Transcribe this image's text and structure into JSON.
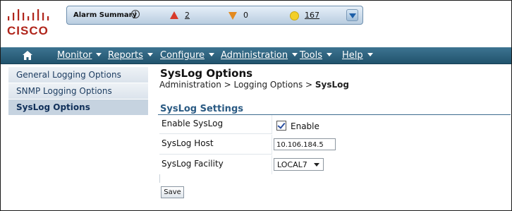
{
  "brand": {
    "logo_text": "CISCO"
  },
  "alarm_summary": {
    "title": "Alarm Summary",
    "critical_count": "2",
    "major_count": "0",
    "minor_count": "167",
    "colors": {
      "critical": "#d83a2a",
      "major": "#e38a1f",
      "minor": "#f2cf2a"
    }
  },
  "nav": {
    "items": [
      {
        "label": "Monitor"
      },
      {
        "label": "Reports"
      },
      {
        "label": "Configure"
      },
      {
        "label": "Administration"
      },
      {
        "label": "Tools"
      },
      {
        "label": "Help"
      }
    ]
  },
  "sidebar": {
    "items": [
      {
        "label": "General Logging Options",
        "active": false
      },
      {
        "label": "SNMP Logging Options",
        "active": false
      },
      {
        "label": "SysLog Options",
        "active": true
      }
    ]
  },
  "page": {
    "title": "SysLog Options",
    "breadcrumb": {
      "path": "Administration > Logging Options > ",
      "current": "SysLog"
    },
    "section_title": "SysLog Settings"
  },
  "form": {
    "enable_label": "Enable SysLog",
    "enable_checkbox_label": "Enable",
    "enable_checked": true,
    "host_label": "SysLog Host",
    "host_value": "10.106.184.5",
    "facility_label": "SysLog Facility",
    "facility_value": "LOCAL7",
    "save_label": "Save"
  }
}
